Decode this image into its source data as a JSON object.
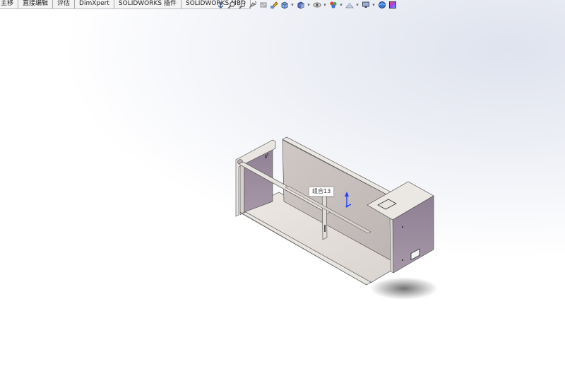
{
  "tabs": [
    {
      "label": "主移"
    },
    {
      "label": "直接编辑"
    },
    {
      "label": "评估"
    },
    {
      "label": "DimXpert"
    },
    {
      "label": "SOLIDWORKS 插件"
    },
    {
      "label": "SOLIDWORKS MBD"
    }
  ],
  "heads_up_toolbar": [
    {
      "icon": "view-orientation-icon"
    },
    {
      "icon": "zoom-to-fit-icon"
    },
    {
      "icon": "zoom-to-area-icon"
    },
    {
      "icon": "previous-view-icon"
    },
    {
      "icon": "section-view-icon"
    },
    {
      "icon": "dynamic-annotation-icon"
    },
    {
      "icon": "view-orientation-cube-icon"
    },
    {
      "icon": "display-style-icon"
    },
    {
      "icon": "hide-show-items-icon"
    },
    {
      "icon": "edit-appearance-icon"
    },
    {
      "icon": "apply-scene-icon"
    },
    {
      "icon": "view-settings-icon"
    },
    {
      "icon": "realview-icon"
    },
    {
      "icon": "color-palette-icon"
    }
  ],
  "model": {
    "tooltip": "组合13",
    "colors": {
      "panel_light": "#e4e0dc",
      "panel_mid": "#c9c3c0",
      "panel_purple": "#9a8a9c",
      "edge": "#3a3a3a",
      "triad_blue": "#1f3fff"
    }
  }
}
